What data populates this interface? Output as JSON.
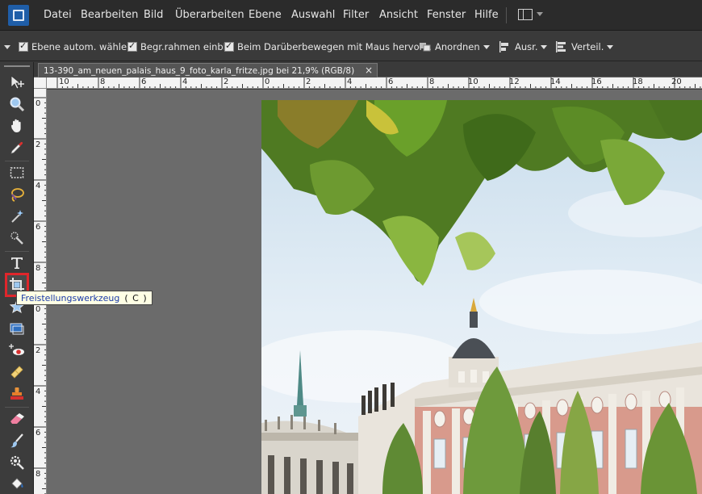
{
  "menu": {
    "items": [
      "Datei",
      "Bearbeiten",
      "Bild",
      "Überarbeiten",
      "Ebene",
      "Auswahl",
      "Filter",
      "Ansicht",
      "Fenster",
      "Hilfe"
    ]
  },
  "options": {
    "auto_select": "Ebene autom. wählen",
    "bounding_box": "Begr.rahmen einbl.",
    "hover_highlight": "Beim Darüberbewegen mit Maus hervorh.",
    "arrange": "Anordnen",
    "align": "Ausr.",
    "distribute": "Verteil."
  },
  "document": {
    "tab_title": "13-390_am_neuen_palais_haus_9_foto_karla_fritze.jpg bei 21,9% (RGB/8)",
    "close_glyph": "×"
  },
  "ruler": {
    "top_labels": [
      "10",
      "8",
      "6",
      "4",
      "2",
      "0",
      "2",
      "4",
      "6",
      "8",
      "10",
      "12",
      "14",
      "16",
      "18",
      "20"
    ],
    "left_labels": [
      "0",
      "2",
      "4",
      "6",
      "8",
      "0",
      "2",
      "4",
      "6",
      "8"
    ]
  },
  "tooltip": {
    "name": "Freistellungswerkzeug",
    "shortcut": "( C )"
  },
  "tools": [
    {
      "icon": "move-icon",
      "active": false
    },
    {
      "icon": "zoom-icon",
      "active": false
    },
    {
      "icon": "hand-icon",
      "active": false
    },
    {
      "icon": "eyedropper-icon",
      "active": false
    },
    {
      "icon": "marquee-icon",
      "active": false
    },
    {
      "icon": "lasso-icon",
      "active": false
    },
    {
      "icon": "magic-wand-icon",
      "active": false
    },
    {
      "icon": "quick-selection-icon",
      "active": false
    },
    {
      "icon": "type-icon",
      "active": false
    },
    {
      "icon": "crop-icon",
      "active": true
    },
    {
      "icon": "cookie-cutter-icon",
      "active": false
    },
    {
      "icon": "straighten-icon",
      "active": false
    },
    {
      "icon": "red-eye-icon",
      "active": false
    },
    {
      "icon": "healing-brush-icon",
      "active": false
    },
    {
      "icon": "clone-stamp-icon",
      "active": false
    },
    {
      "icon": "eraser-icon",
      "active": false
    },
    {
      "icon": "brush-icon",
      "active": false
    },
    {
      "icon": "smart-brush-icon",
      "active": false
    },
    {
      "icon": "paint-bucket-icon",
      "active": false
    }
  ],
  "colors": {
    "accent_highlight": "#e0262b",
    "app_logo": "#1f5ea8",
    "tooltip_text": "#1a3aa8"
  }
}
